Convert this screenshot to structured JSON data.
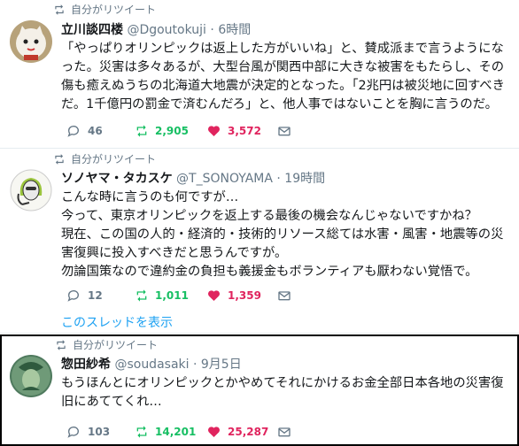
{
  "tweets": [
    {
      "retweet_label": "自分がリツイート",
      "name": "立川談四楼",
      "handle": "@Dgoutokuji",
      "time": "6時間",
      "text": "「やっぱりオリンピックは返上した方がいいね」と、賛成派まで言うようになった。災害は多々あるが、大型台風が関西中部に大きな被害をもたらし、その傷も癒えぬうちの北海道大地震が決定的となった。「2兆円は被災地に回すべきだ。1千億円の罰金で済むんだろ」と、他人事ではないことを胸に言うのだ。",
      "replies": "46",
      "retweets": "2,905",
      "likes": "3,572"
    },
    {
      "retweet_label": "自分がリツイート",
      "name": "ソノヤマ・タカスケ",
      "handle": "@T_SONOYAMA",
      "time": "19時間",
      "text": "こんな時に言うのも何ですが…\n今って、東京オリンピックを返上する最後の機会なんじゃないですかね？\n現在、この国の人的・経済的・技術的リソース総ては水害・風害・地震等の災害復興に投入すべきだと思うんですが。\n勿論国策なので違約金の負担も義援金もボランティアも厭わない覚悟で。",
      "replies": "12",
      "retweets": "1,011",
      "likes": "1,359",
      "thread_link": "このスレッドを表示"
    },
    {
      "retweet_label": "自分がリツイート",
      "name": "惣田紗希",
      "handle": "@soudasaki",
      "time": "9月5日",
      "text": "もうほんとにオリンピックとかやめてそれにかけるお金全部日本各地の災害復旧にあててくれ…",
      "replies": "103",
      "retweets": "14,201",
      "likes": "25,287"
    }
  ],
  "separator": "·",
  "colors": {
    "accent": "#1da1f2",
    "retweet": "#17bf63",
    "like": "#e0245e",
    "muted": "#657786"
  }
}
